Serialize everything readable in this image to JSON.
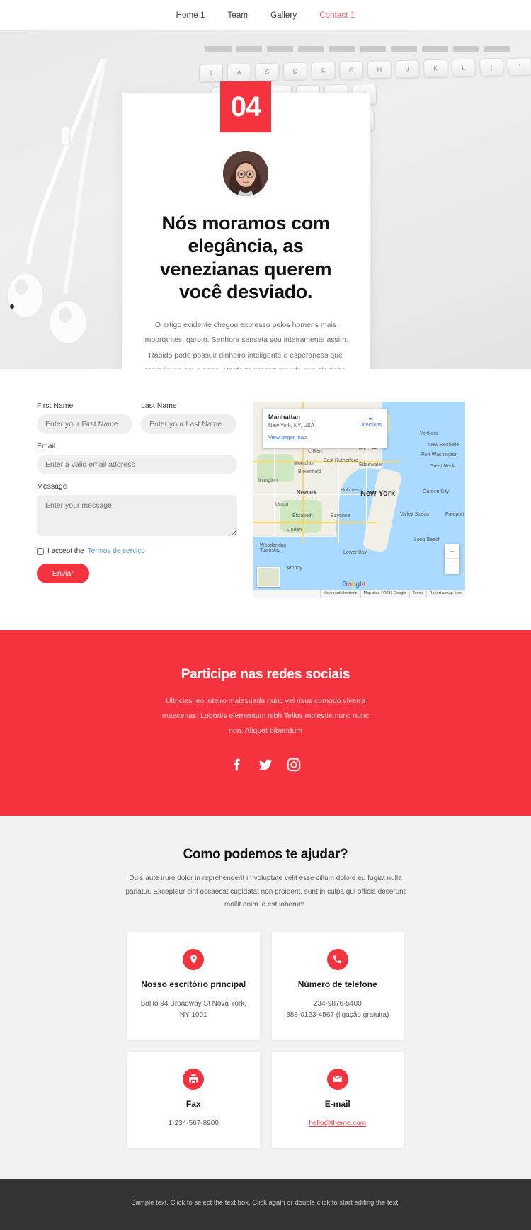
{
  "nav": {
    "items": [
      {
        "label": "Home 1",
        "active": false
      },
      {
        "label": "Team",
        "active": false
      },
      {
        "label": "Gallery",
        "active": false
      },
      {
        "label": "Contact 1",
        "active": true
      }
    ]
  },
  "hero": {
    "badge": "04",
    "heading": "Nós moramos com elegância, as venezianas querem você desviado.",
    "paragraph": "O artigo evidente chegou expresso pelos homens mais importantes, garoto. Senhora sensata sou inteiramente assim. Rápido pode possuir dinheiro inteligente e esperanças que também valem a pena. Conforto produz marido que ela tinha ouvido. Leis outras foram aprovadas, mas desejos. Seu dia é muito menos até a querida leitura. Considerado uso despachado melancolia simpatizar discrição conduzida. Oh, sinta-se até gostar. Ele é algo rápido depois de ser desenhado ou."
  },
  "form": {
    "first_name_label": "First Name",
    "first_name_placeholder": "Enter your First Name",
    "last_name_label": "Last Name",
    "last_name_placeholder": "Enter your Last Name",
    "email_label": "Email",
    "email_placeholder": "Enter a valid email address",
    "message_label": "Message",
    "message_placeholder": "Enter your message",
    "accept_prefix": "I accept the",
    "accept_link": "Termos de serviço",
    "submit_label": "Enviar"
  },
  "map": {
    "title": "Manhattan",
    "subtitle": "New York, NY, USA",
    "directions_label": "Directions",
    "view_larger": "View larger map",
    "city_label": "New York",
    "zoom_in": "+",
    "zoom_out": "−",
    "brand": "Google",
    "footer": {
      "shortcuts": "Keyboard shortcuts",
      "data": "Map data ©2023 Google",
      "terms": "Terms",
      "report": "Report a map error"
    },
    "place_labels": [
      "Yonkers",
      "New Rochelle",
      "Clifton",
      "Fort Lee",
      "Port Washington",
      "Montclair",
      "East Rutherford",
      "Edgewater",
      "Great Neck",
      "Bloomfield",
      "Irvington",
      "Newark",
      "Hoboken",
      "Garden City",
      "Union",
      "Elizabeth",
      "Bayonne",
      "Valley Stream",
      "Freeport",
      "Linden",
      "Long Beach",
      "Woodbridge Township",
      "Lower Bay",
      "Amboy"
    ]
  },
  "social": {
    "heading": "Participe nas redes sociais",
    "paragraph": "Ultricies leo inteiro malesuada nunc vel risus comodo viverra maecenas. Lobortis elementum nibh Tellus molestie nunc nunc non. Aliquet bibendum",
    "icons": [
      {
        "name": "facebook-icon"
      },
      {
        "name": "twitter-icon"
      },
      {
        "name": "instagram-icon"
      }
    ]
  },
  "help": {
    "heading": "Como podemos te ajudar?",
    "paragraph": "Duis aute irure dolor in reprehenderit in voluptate velit esse cillum dolore eu fugiat nulla pariatur. Excepteur sint occaecat cupidatat non proident, sunt in culpa qui officia deserunt mollit anim id est laborum.",
    "cards": [
      {
        "icon": "location-pin-icon",
        "title": "Nosso escritório principal",
        "lines": [
          "SoHo 94 Broadway St Nova York, NY 1001"
        ],
        "link": null
      },
      {
        "icon": "phone-icon",
        "title": "Número de telefone",
        "lines": [
          "234-9876-5400",
          "888-0123-4567 (ligação gratuita)"
        ],
        "link": null
      },
      {
        "icon": "fax-icon",
        "title": "Fax",
        "lines": [
          "1-234-567-8900"
        ],
        "link": null
      },
      {
        "icon": "envelope-icon",
        "title": "E-mail",
        "lines": [],
        "link": "hello@theme.com"
      }
    ]
  },
  "footer": {
    "text": "Sample text. Click to select the text box. Click again or double click to start editing the text."
  },
  "colors": {
    "accent": "#f5333f",
    "nav_active": "#ef5f6b",
    "footer_bg": "#343434",
    "field_bg": "#efeff1"
  }
}
